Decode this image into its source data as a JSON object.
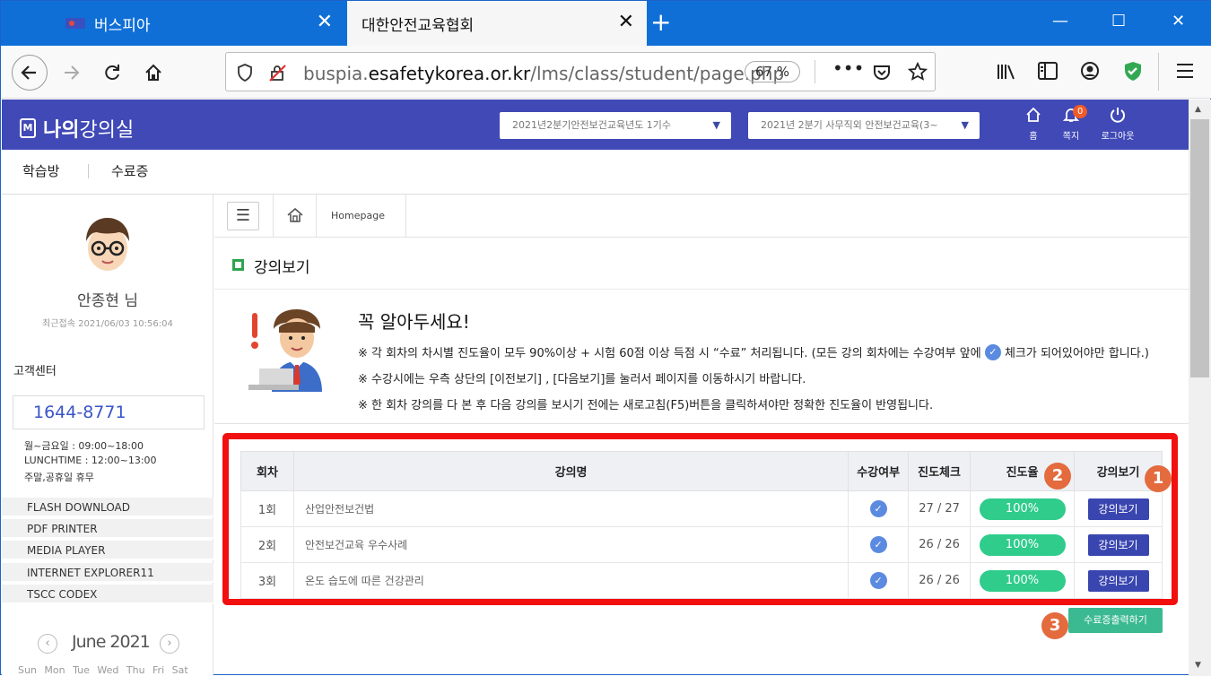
{
  "browser": {
    "tabs": [
      {
        "title": "버스피아",
        "close": "✕"
      },
      {
        "title": "대한안전교육협회",
        "close": "✕"
      }
    ],
    "new_tab": "+",
    "window_controls": [
      "—",
      "☐",
      "✕"
    ],
    "url_domain_prefix": "buspia.",
    "url_domain": "esafetykorea.or.kr",
    "url_path": "/lms/class/student/page.php",
    "zoom": "67 %"
  },
  "header": {
    "logo_mark": "M",
    "logo_bold": "나의",
    "logo_rest": "강의실",
    "select1": "2021년2분기안전보건교육년도 1기수",
    "select2": "2021년 2분기 사무직외 안전보건교육(3~",
    "icons": [
      {
        "icon": "home-icon",
        "label": "홈"
      },
      {
        "icon": "bell-icon",
        "label": "쪽지",
        "badge": "0"
      },
      {
        "icon": "power-icon",
        "label": "로그아웃"
      }
    ]
  },
  "subnav": {
    "items": [
      "학습방",
      "수료증"
    ]
  },
  "sidebar": {
    "user_name": "안종현 님",
    "last_login": "최근접속 2021/06/03 10:56:04",
    "cs_title": "고객센터",
    "phone": "1644-8771",
    "hours": [
      "월~금요일 : 09:00~18:00",
      "LUNCHTIME : 12:00~13:00",
      "주말,공휴일 휴무"
    ],
    "downloads": [
      "FLASH DOWNLOAD",
      "PDF PRINTER",
      "MEDIA PLAYER",
      "INTERNET EXPLORER11",
      "TSCC CODEX"
    ],
    "calendar": {
      "month": "June 2021",
      "weekdays": "Sun Mon Tue Wed Thu Fri Sat"
    }
  },
  "breadcrumb": {
    "text": "Homepage"
  },
  "page_title": "강의보기",
  "notice": {
    "title": "꼭 알아두세요!",
    "line1_a": "※ 각 회차의 차시별 진도율이 모두 90%이상 + 시험 60점 이상 득점 시 “수료” 처리됩니다. (모든 강의 회차에는 수강여부 앞에",
    "line1_b": "체크가 되어있어야만 합니다.)",
    "line2": "※ 수강시에는 우측 상단의 [이전보기] , [다음보기]를 눌러서 페이지를 이동하시기 바랍니다.",
    "line3": "※ 한 회차 강의를 다 본 후 다음 강의를 보시기 전에는 새로고침(F5)버튼을 클릭하셔야만 정확한 진도율이 반영됩니다."
  },
  "table": {
    "headers": [
      "회차",
      "강의명",
      "수강여부",
      "진도체크",
      "진도율",
      "강의보기"
    ],
    "rows": [
      {
        "round": "1회",
        "name": "산업안전보건법",
        "check": "27 / 27",
        "progress": "100%",
        "button": "강의보기"
      },
      {
        "round": "2회",
        "name": "안전보건교육 우수사례",
        "check": "26 / 26",
        "progress": "100%",
        "button": "강의보기"
      },
      {
        "round": "3회",
        "name": "온도 습도에 따른 건강관리",
        "check": "26 / 26",
        "progress": "100%",
        "button": "강의보기"
      }
    ]
  },
  "markers": [
    "1",
    "2",
    "3"
  ],
  "cert_button": "수료증출력하기",
  "colors": {
    "header_bg": "#4049b6",
    "tab_bar": "#0f6fd7",
    "highlight": "#f20f0f",
    "progress": "#2fcc8c",
    "view_btn": "#3a46b0"
  }
}
